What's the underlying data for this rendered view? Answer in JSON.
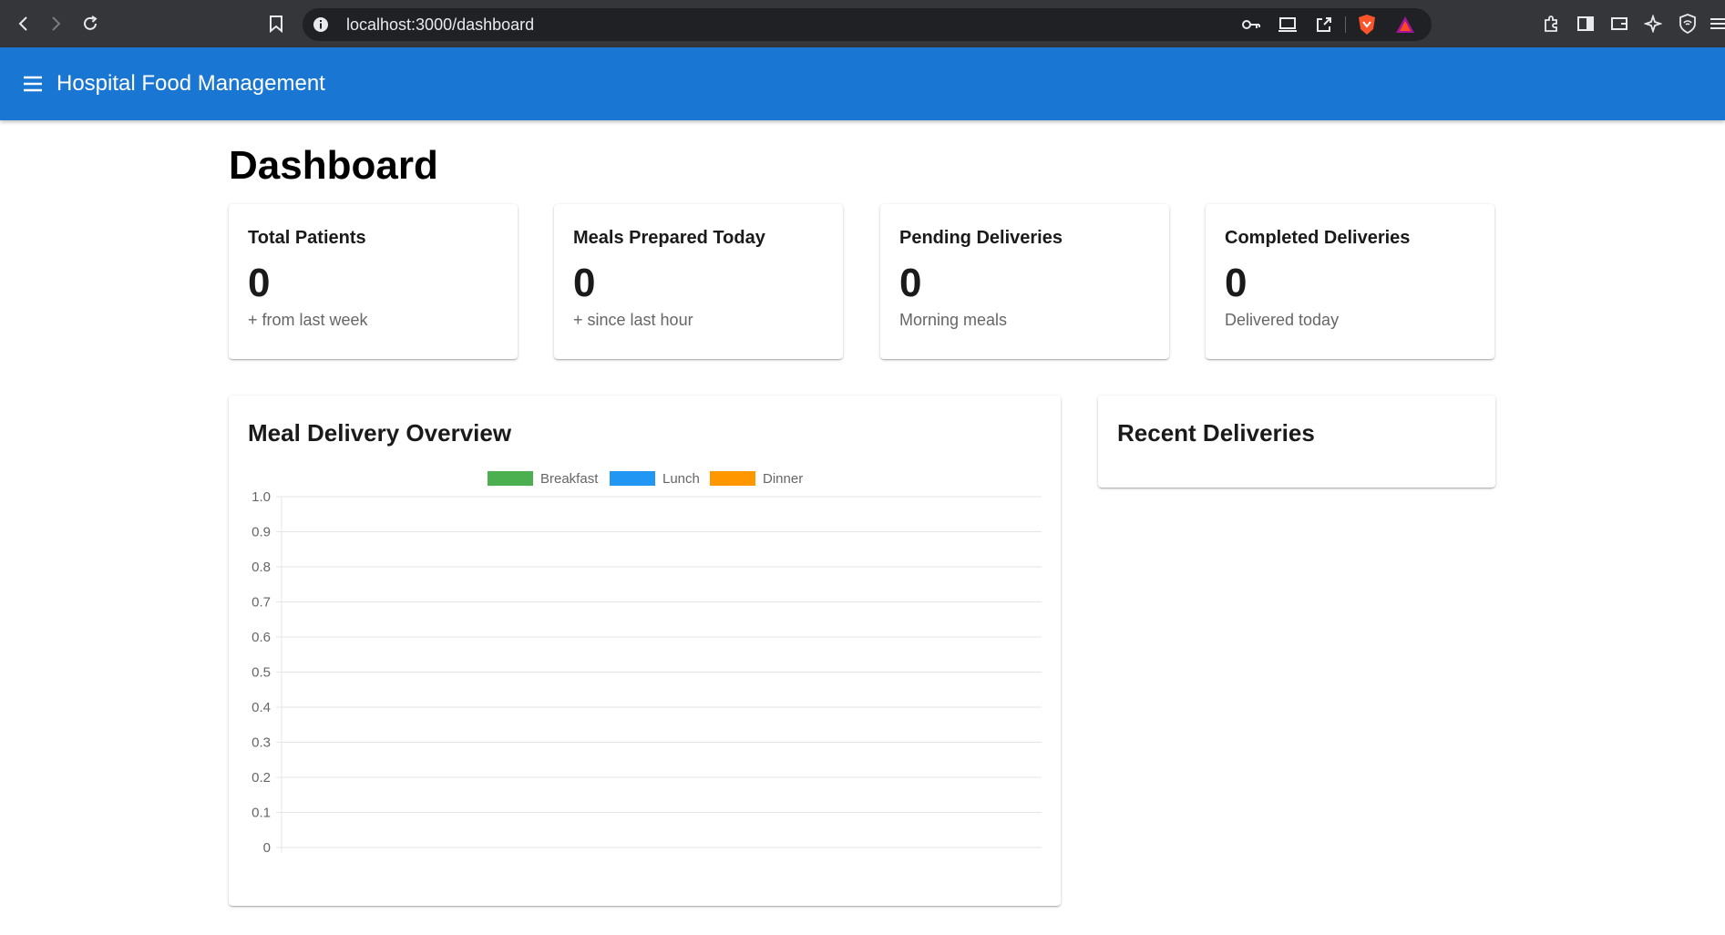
{
  "browser": {
    "url": "localhost:3000/dashboard"
  },
  "app": {
    "title": "Hospital Food Management"
  },
  "page": {
    "title": "Dashboard"
  },
  "stats": [
    {
      "title": "Total Patients",
      "value": "0",
      "subtitle": "+ from last week"
    },
    {
      "title": "Meals Prepared Today",
      "value": "0",
      "subtitle": "+ since last hour"
    },
    {
      "title": "Pending Deliveries",
      "value": "0",
      "subtitle": "Morning meals"
    },
    {
      "title": "Completed Deliveries",
      "value": "0",
      "subtitle": "Delivered today"
    }
  ],
  "overview": {
    "title": "Meal Delivery Overview"
  },
  "recent": {
    "title": "Recent Deliveries"
  },
  "colors": {
    "appbar": "#1976d2",
    "breakfast": "#4caf50",
    "lunch": "#2196f3",
    "dinner": "#ff9800"
  },
  "chart_data": {
    "type": "bar",
    "categories": [],
    "series": [
      {
        "name": "Breakfast",
        "color": "#4caf50",
        "values": []
      },
      {
        "name": "Lunch",
        "color": "#2196f3",
        "values": []
      },
      {
        "name": "Dinner",
        "color": "#ff9800",
        "values": []
      }
    ],
    "title": "Meal Delivery Overview",
    "xlabel": "",
    "ylabel": "",
    "ylim": [
      0,
      1
    ],
    "y_ticks": [
      "1.0",
      "0.9",
      "0.8",
      "0.7",
      "0.6",
      "0.5",
      "0.4",
      "0.3",
      "0.2",
      "0.1",
      "0"
    ],
    "grid": true,
    "legend": "top-center"
  }
}
